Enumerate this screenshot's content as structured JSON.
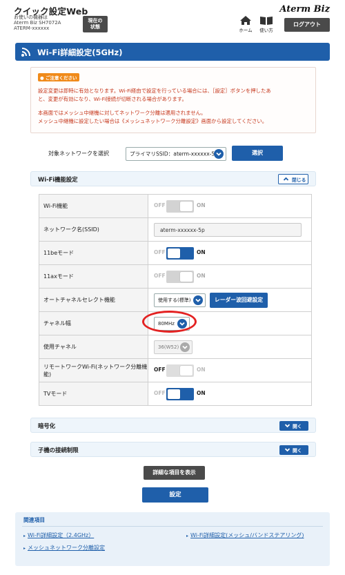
{
  "header": {
    "app_title": "クイック設定Web",
    "device_lines": [
      "お使いの機器は",
      "Aterm Biz SH7072A",
      "ATERM-xxxxxx"
    ],
    "status_button": [
      "現在の",
      "状態"
    ],
    "home_label": "ホーム",
    "help_label": "使い方",
    "brand": "Aterm Biz",
    "logout_label": "ログアウト"
  },
  "page_title": "Wi-Fi詳細設定(5GHz)",
  "notice": {
    "badge": "ご注意ください",
    "lines": [
      "設定変更は即時に有効となります。Wi-Fi経由で設定を行っている場合には、［設定］ボタンを押したあ",
      "と、変更が有効になり、Wi-Fi接続が切断される場合があります。",
      "本画面ではメッシュ中継機に対してネットワーク分離は適用されません。",
      "メッシュ中継機に設定したい場合は《メッシュネットワーク分離設定》画面から設定してください。"
    ]
  },
  "network_select": {
    "label": "対象ネットワークを選択",
    "value": "プライマリSSID：aterm-xxxxxx-5p",
    "button": "選択"
  },
  "wifi_function": {
    "header": "Wi-Fi機能設定",
    "collapse_label": "閉じる",
    "toggle_off": "OFF",
    "toggle_on": "ON",
    "rows": {
      "wifi": {
        "label": "Wi-Fi機能",
        "state": "off"
      },
      "ssid": {
        "label": "ネットワーク名(SSID)",
        "value": "aterm-xxxxxx-5p"
      },
      "be": {
        "label": "11beモード",
        "state": "on"
      },
      "ax": {
        "label": "11axモード",
        "state": "off"
      },
      "acs": {
        "label": "オートチャネルセレクト機能",
        "value": "使用する(標準)",
        "button": "レーダー波回避設定"
      },
      "bandwidth": {
        "label": "チャネル幅",
        "value": "80MHz"
      },
      "channel": {
        "label": "使用チャネル",
        "value": "36(W52)"
      },
      "remote": {
        "label": "リモートワークWi-Fi(ネットワーク分離機能)",
        "state": "off"
      },
      "tv": {
        "label": "TVモード",
        "state": "on"
      }
    }
  },
  "encryption": {
    "header": "暗号化",
    "expand_label": "開く"
  },
  "client_limit": {
    "header": "子機の接続制限",
    "expand_label": "開く"
  },
  "show_details_button": "詳細な項目を表示",
  "apply_button": "設定",
  "related": {
    "header": "関連項目",
    "links": [
      "Wi-Fi詳細設定（2.4GHz）",
      "Wi-Fi詳細設定(メッシュ/バンドステアリング)",
      "メッシュネットワーク分離設定"
    ]
  },
  "colors": {
    "accent": "#1f5faa",
    "notice_text": "#c5361b",
    "highlight": "#e32222",
    "badge": "#f08a1a"
  }
}
